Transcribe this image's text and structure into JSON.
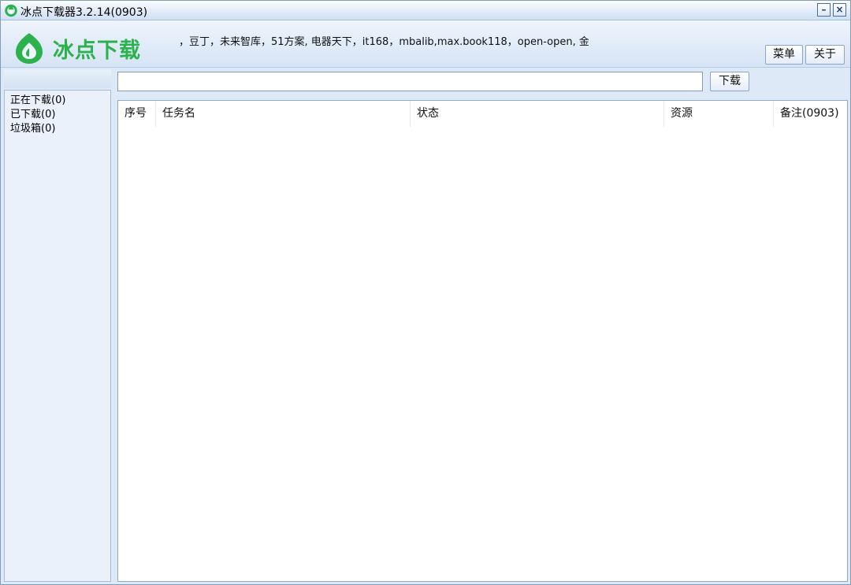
{
  "window": {
    "title": "冰点下载器3.2.14(0903)",
    "minimize_label": "–",
    "close_label": "×"
  },
  "banner": {
    "logo_text": "冰点下载",
    "marquee_text": "，豆丁，未来智库，51方案, 电器天下，it168，mbalib,max.book118，open-open, 金",
    "menu_label": "菜单",
    "about_label": "关于"
  },
  "sidebar": {
    "items": [
      {
        "label": "正在下载(0)"
      },
      {
        "label": "已下载(0)"
      },
      {
        "label": "垃圾箱(0)"
      }
    ]
  },
  "download_bar": {
    "url_value": "",
    "download_label": "下载"
  },
  "task_table": {
    "columns": [
      "序号",
      "任务名",
      "状态",
      "资源",
      "备注(0903)"
    ],
    "rows": []
  },
  "colors": {
    "brand_green": "#2bb24c",
    "window_bg": "#dde9f7",
    "border": "#7f9db9"
  }
}
